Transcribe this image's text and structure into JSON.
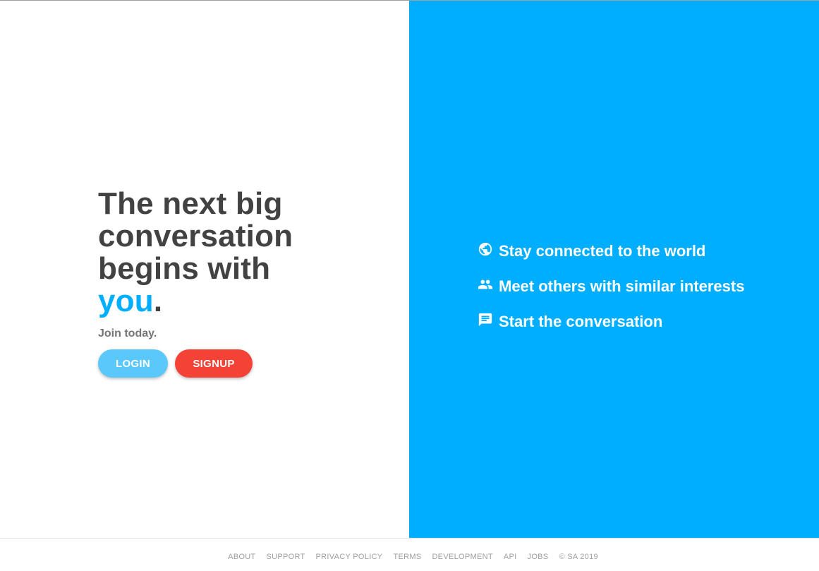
{
  "hero": {
    "headline_line1": "The next big",
    "headline_line2": "conversation",
    "headline_line3": "begins with",
    "headline_accent": "you",
    "headline_period": ".",
    "tagline": "Join today."
  },
  "buttons": {
    "login_label": "LOGIN",
    "signup_label": "SIGNUP"
  },
  "features": [
    {
      "icon": "globe-icon",
      "text": "Stay connected to the world"
    },
    {
      "icon": "people-icon",
      "text": "Meet others with similar interests"
    },
    {
      "icon": "chat-icon",
      "text": "Start the conversation"
    }
  ],
  "footer": {
    "links": [
      "ABOUT",
      "SUPPORT",
      "PRIVACY POLICY",
      "TERMS",
      "DEVELOPMENT",
      "API",
      "JOBS"
    ],
    "copyright": "© SA 2019"
  },
  "colors": {
    "accent": "#00aeff",
    "login": "#5bc8fb",
    "signup": "#f44336",
    "headline": "#424242"
  }
}
